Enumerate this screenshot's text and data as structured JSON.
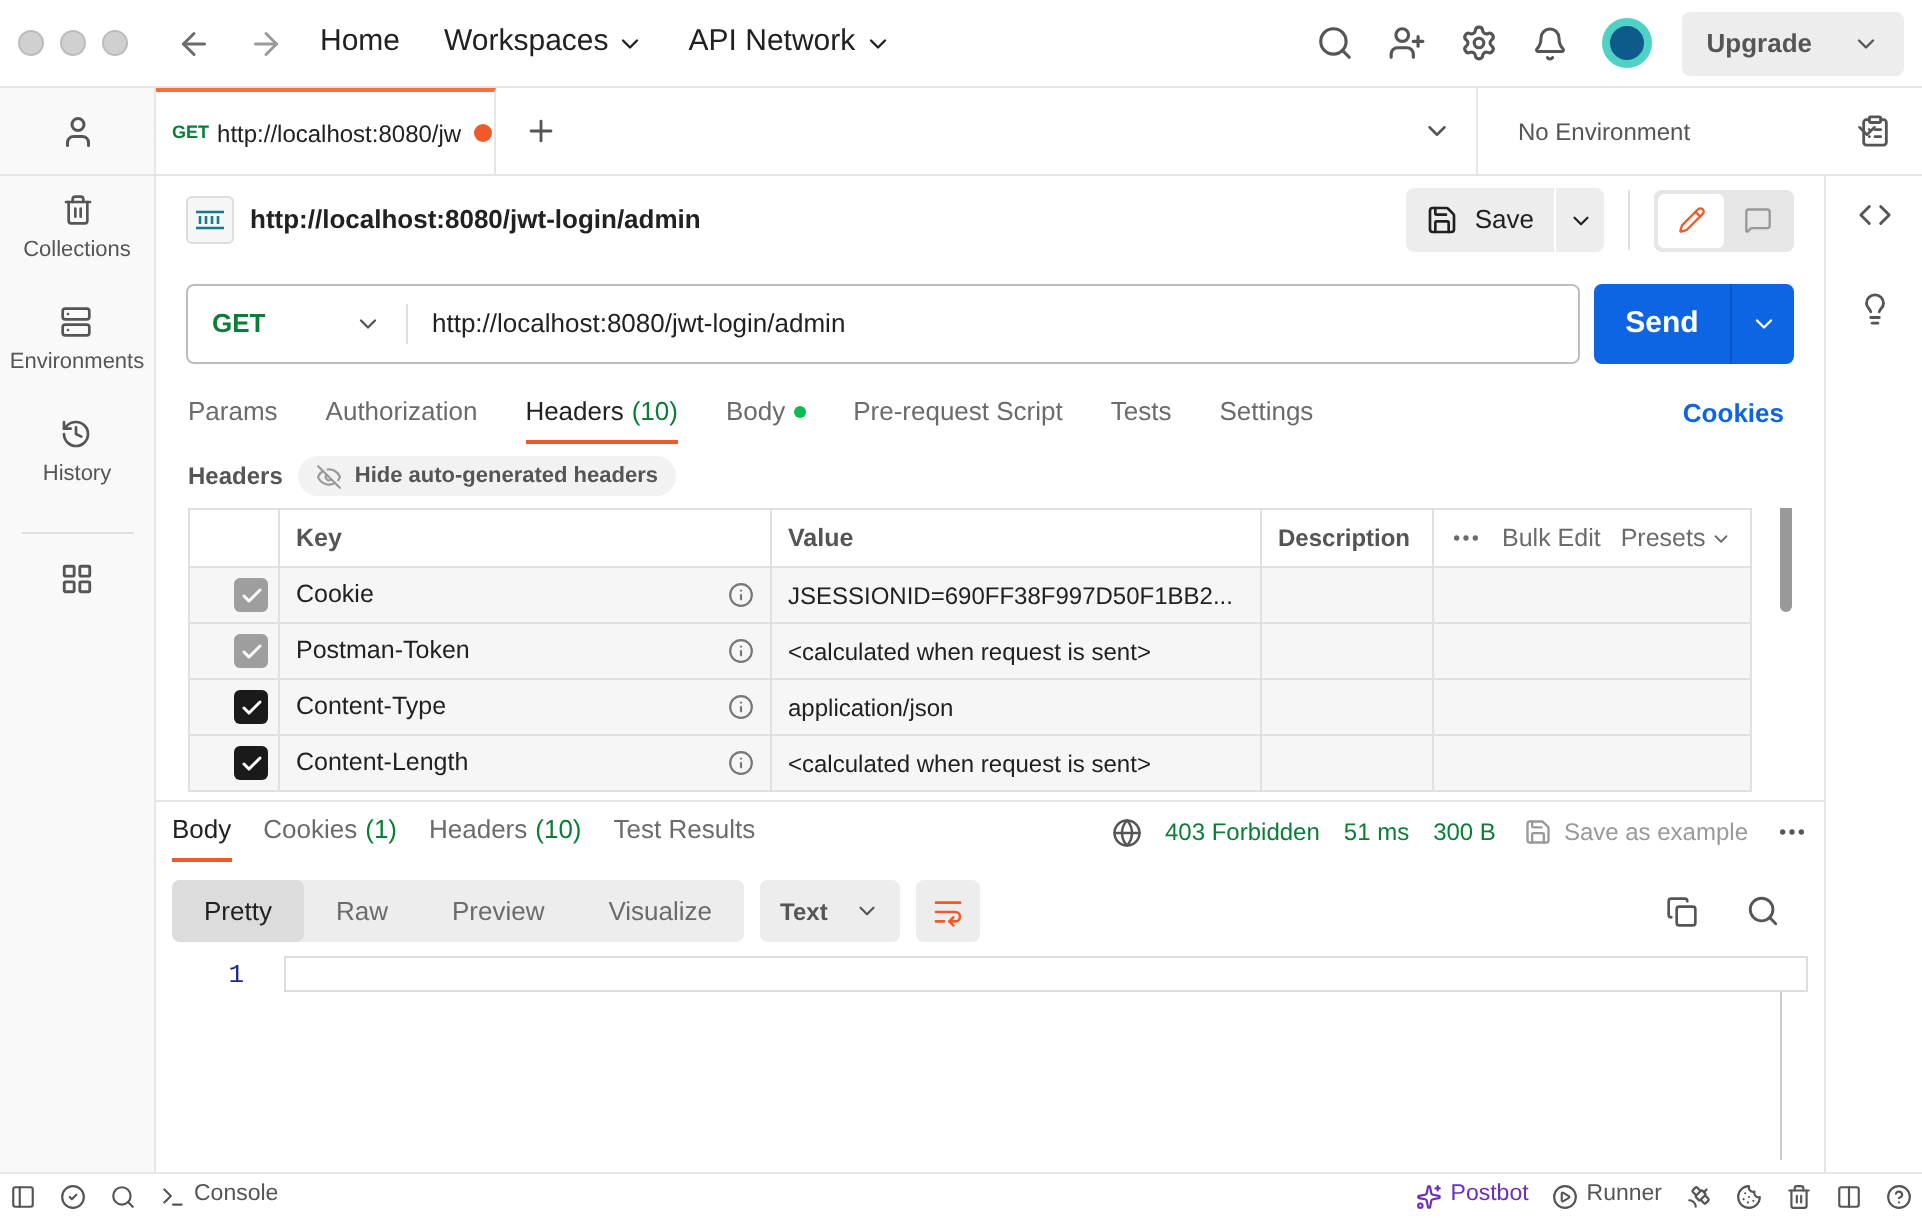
{
  "top_nav": [
    {
      "label": "Home",
      "dropdown": false
    },
    {
      "label": "Workspaces",
      "dropdown": true
    },
    {
      "label": "API Network",
      "dropdown": true
    }
  ],
  "upgrade": "Upgrade",
  "sidebar": {
    "items": [
      {
        "label": "Collections"
      },
      {
        "label": "Environments"
      },
      {
        "label": "History"
      }
    ]
  },
  "open_tabs": [
    {
      "method": "GET",
      "title": "http://localhost:8080/jw",
      "unsaved": true,
      "selected": true
    }
  ],
  "environment": "No Environment",
  "modes": [
    {
      "kind": "edit",
      "selected": true
    },
    {
      "kind": "comment",
      "selected": false
    }
  ],
  "request": {
    "name": "http://localhost:8080/jwt-login/admin",
    "method": "GET",
    "url": "http://localhost:8080/jwt-login/admin",
    "save": "Save",
    "send": "Send"
  },
  "request_tabs": [
    {
      "label": "Params",
      "selected": false
    },
    {
      "label": "Authorization",
      "selected": false
    },
    {
      "label": "Headers",
      "count": "(10)",
      "selected": true
    },
    {
      "label": "Body",
      "dot": true,
      "selected": false
    },
    {
      "label": "Pre-request Script",
      "selected": false
    },
    {
      "label": "Tests",
      "selected": false
    },
    {
      "label": "Settings",
      "selected": false
    }
  ],
  "cookies_link": "Cookies",
  "headers": {
    "title": "Headers",
    "toggle": "Hide auto-generated headers",
    "columns": [
      "Key",
      "Value",
      "Description"
    ],
    "bulk_edit": "Bulk Edit",
    "presets": "Presets",
    "rows": [
      {
        "key": "Cookie",
        "value": "JSESSIONID=690FF38F997D50F1BB2...",
        "checked": true,
        "disabled": true
      },
      {
        "key": "Postman-Token",
        "value": "<calculated when request is sent>",
        "checked": true,
        "disabled": true
      },
      {
        "key": "Content-Type",
        "value": "application/json",
        "checked": true,
        "disabled": false
      },
      {
        "key": "Content-Length",
        "value": "<calculated when request is sent>",
        "checked": true,
        "disabled": false
      }
    ]
  },
  "response": {
    "tabs": [
      {
        "label": "Body",
        "selected": true
      },
      {
        "label": "Cookies",
        "count": "(1)",
        "selected": false
      },
      {
        "label": "Headers",
        "count": "(10)",
        "selected": false
      },
      {
        "label": "Test Results",
        "selected": false
      }
    ],
    "status": "403 Forbidden",
    "time": "51 ms",
    "size": "300 B",
    "save_example": "Save as example",
    "views": [
      {
        "label": "Pretty",
        "selected": true
      },
      {
        "label": "Raw",
        "selected": false
      },
      {
        "label": "Preview",
        "selected": false
      },
      {
        "label": "Visualize",
        "selected": false
      }
    ],
    "format": "Text",
    "line_numbers": [
      "1"
    ]
  },
  "status_bar": {
    "console": "Console",
    "postbot": "Postbot",
    "runner": "Runner"
  }
}
